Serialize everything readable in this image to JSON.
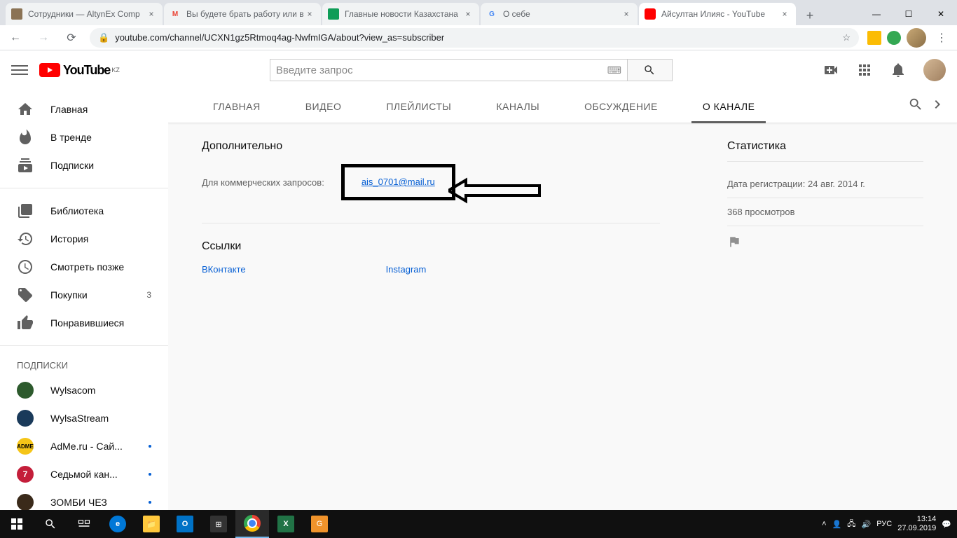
{
  "browser": {
    "tabs": [
      {
        "title": "Сотрудники — AltynEx Comp",
        "favicon_bg": "#8b7355"
      },
      {
        "title": "Вы будете брать работу или в",
        "favicon_bg": "#ea4335"
      },
      {
        "title": "Главные новости Казахстана",
        "favicon_bg": "#0f9d58"
      },
      {
        "title": "О себе",
        "favicon_bg": "#4285f4"
      },
      {
        "title": "Айсултан Илияс - YouTube",
        "favicon_bg": "#ff0000"
      }
    ],
    "url": "youtube.com/channel/UCXN1gz5Rtmoq4ag-NwfmIGA/about?view_as=subscriber"
  },
  "yt": {
    "logo_text": "YouTube",
    "logo_region": "KZ",
    "search_placeholder": "Введите запрос"
  },
  "sidebar": {
    "home": "Главная",
    "trending": "В тренде",
    "subscriptions": "Подписки",
    "library": "Библиотека",
    "history": "История",
    "watch_later": "Смотреть позже",
    "purchases": "Покупки",
    "purchases_count": "3",
    "liked": "Понравившиеся",
    "subs_heading": "ПОДПИСКИ",
    "subs": [
      {
        "name": "Wylsacom",
        "bg": "#2d5a2d",
        "dot": false
      },
      {
        "name": "WylsaStream",
        "bg": "#1a3a5a",
        "dot": false
      },
      {
        "name": "AdMe.ru - Сай...",
        "bg": "#f5c518",
        "dot": true
      },
      {
        "name": "Седьмой кан...",
        "bg": "#c41e3a",
        "dot": true
      },
      {
        "name": "ЗОМБИ ЧЕЗ",
        "bg": "#3a2a1a",
        "dot": true
      }
    ]
  },
  "tabs": {
    "main": "ГЛАВНАЯ",
    "videos": "ВИДЕО",
    "playlists": "ПЛЕЙЛИСТЫ",
    "channels": "КАНАЛЫ",
    "discussion": "ОБСУЖДЕНИЕ",
    "about": "О КАНАЛЕ"
  },
  "about": {
    "additional": "Дополнительно",
    "inquiry_label": "Для коммерческих запросов:",
    "email": "ais_0701@mail.ru",
    "links_heading": "Ссылки",
    "link_vk": "ВКонтакте",
    "link_ig": "Instagram",
    "stats_heading": "Статистика",
    "join_date": "Дата регистрации: 24 авг. 2014 г.",
    "views": "368 просмотров"
  },
  "taskbar": {
    "lang": "РУС",
    "time": "13:14",
    "date": "27.09.2019"
  }
}
